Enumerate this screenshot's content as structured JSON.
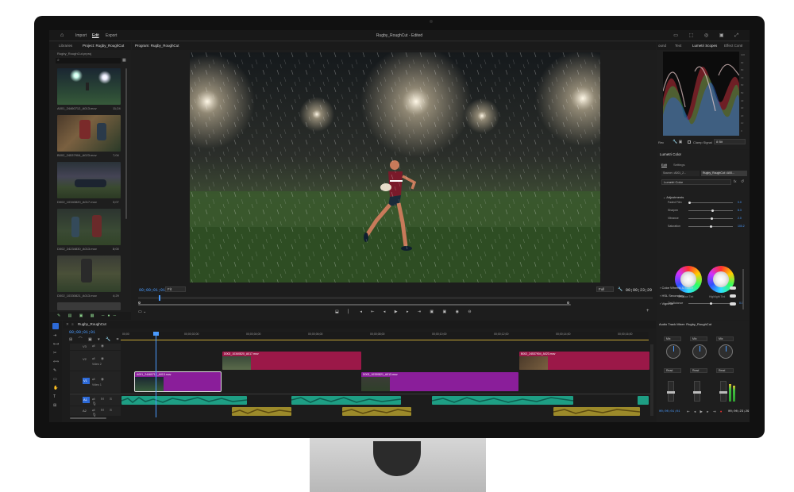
{
  "app": {
    "menu": [
      "Import",
      "Edit",
      "Export"
    ],
    "active_menu": "Edit",
    "title": "Rugby_RoughCut - Edited"
  },
  "project": {
    "tabs": [
      "Libraries",
      "Project: Rugby_RoughCut"
    ],
    "file": "Rugby_RoughCut.prproj",
    "clips": [
      {
        "name": "A001_24460712_A013.mov",
        "dur": "11;24"
      },
      {
        "name": "B002_24537904_A023.mov",
        "dur": "7;04"
      },
      {
        "name": "D002_10340820_A017.mov",
        "dur": "3;07"
      },
      {
        "name": "D002_24234830_A013.mov",
        "dur": "8;00"
      },
      {
        "name": "D002_10330821_A013.mov",
        "dur": "4;29"
      }
    ]
  },
  "program": {
    "tab": "Program: Rugby_RoughCut",
    "timecode_in": "00;00;01;01",
    "fit": "Fit",
    "quality": "Full",
    "timecode_out": "00;00;23;29"
  },
  "scopes": {
    "tabs": [
      "ound",
      "Text",
      "Lumetri Scopes",
      "Effect Contr"
    ],
    "labels": [
      "Rec",
      "Clamp Signal",
      "8 Bit"
    ],
    "scale_right": [
      "100",
      "90",
      "80",
      "70",
      "60",
      "50",
      "40",
      "30",
      "20",
      "10",
      "0"
    ]
  },
  "lumetri": {
    "title": "Lumetri Color",
    "tabs": [
      "Edit",
      "Settings"
    ],
    "source": "Source • A001_2...",
    "sequence": "Rugby_RoughCut • A00...",
    "effect": "Lumetri Color",
    "fx": "fx",
    "section": "Adjustments",
    "sliders": [
      {
        "label": "Faded Film",
        "value": "0.0",
        "pos": 0.0
      },
      {
        "label": "Sharpen",
        "value": "8.3",
        "pos": 0.54
      },
      {
        "label": "Vibrance",
        "value": "2.0",
        "pos": 0.52
      },
      {
        "label": "Saturation",
        "value": "100.2",
        "pos": 0.5
      }
    ],
    "wheels": [
      "Shadow Tint",
      "Highlight Tint"
    ],
    "tint_balance": {
      "label": "Tint Balance",
      "value": "0.0",
      "pos": 0.5
    },
    "sections": [
      "Curves",
      "Color Wheels & Match",
      "HSL Secondary",
      "Vignette"
    ]
  },
  "timeline": {
    "sequence": "Rugby_RoughCut",
    "timecode": "00;00;01;01",
    "ruler": [
      "00;00",
      "00;00;02;00",
      "00;00;04;00",
      "00;00;06;00",
      "00;00;08;00",
      "00;00;10;00",
      "00;00;12;00",
      "00;00;14;00",
      "00;00;16;00"
    ],
    "tracks": {
      "v3": "V3",
      "v2": "V2",
      "v2_name": "Video 2",
      "v1": "V1",
      "v1_name": "Video 1",
      "a1": "A1",
      "a2": "A2"
    },
    "clips_v2": [
      "D002_10340820_A017.mov",
      "B002_24537904_A023.mov"
    ],
    "clips_v1": [
      "A001_24460712_A013.mov",
      "D002_10330821_A013.mov"
    ]
  },
  "mixer": {
    "title": "Audio Track Mixer: Rugby_RoughCut",
    "sends": [
      "Mix",
      "Mix",
      "Mix"
    ],
    "read": [
      "Read",
      "Read",
      "Read"
    ],
    "timecode_left": "00;00;01;01",
    "timecode_right": "00;00;23;29"
  },
  "colors": {
    "accent_blue": "#4a9bff",
    "clip_red": "#9b1848",
    "clip_purple": "#8a1e9a",
    "clip_teal": "#1e9e84",
    "clip_gold": "#9c8a2a"
  }
}
